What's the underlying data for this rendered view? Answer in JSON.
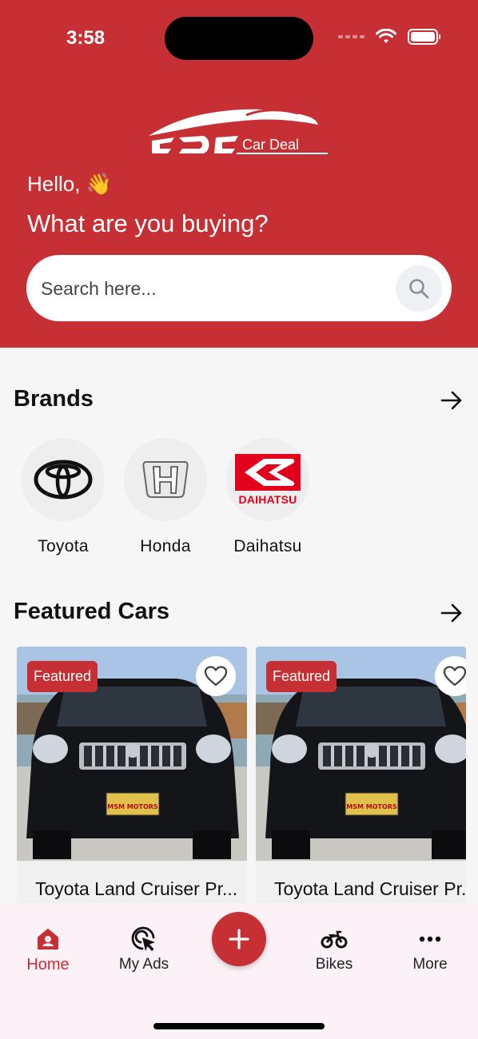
{
  "status_bar": {
    "time": "3:58"
  },
  "header": {
    "logo_text": "Car Deal",
    "greeting": "Hello, 👋",
    "headline": "What are you buying?",
    "search": {
      "placeholder": "Search here..."
    }
  },
  "brands": {
    "title": "Brands",
    "items": [
      {
        "label": "Toyota",
        "icon": "toyota-logo"
      },
      {
        "label": "Honda",
        "icon": "honda-logo"
      },
      {
        "label": "Daihatsu",
        "icon": "daihatsu-logo",
        "logo_text": "DAIHATSU"
      }
    ]
  },
  "featured": {
    "title": "Featured Cars",
    "cards": [
      {
        "badge": "Featured",
        "title": "Toyota Land Cruiser Prado",
        "plate": "MSM MOTORS"
      },
      {
        "badge": "Featured",
        "title": "Toyota Land Cruiser Prado",
        "plate": "MSM MOTORS"
      }
    ]
  },
  "bottom_nav": {
    "items": [
      {
        "label": "Home",
        "icon": "home-icon",
        "active": true
      },
      {
        "label": "My Ads",
        "icon": "target-cursor-icon"
      },
      {
        "label": "Bikes",
        "icon": "motorbike-icon"
      },
      {
        "label": "More",
        "icon": "more-dots-icon"
      }
    ],
    "fab_icon": "plus-icon"
  },
  "colors": {
    "brand_red": "#c63035",
    "background": "#f7f6f7",
    "nav_background": "#fbf1f6"
  }
}
